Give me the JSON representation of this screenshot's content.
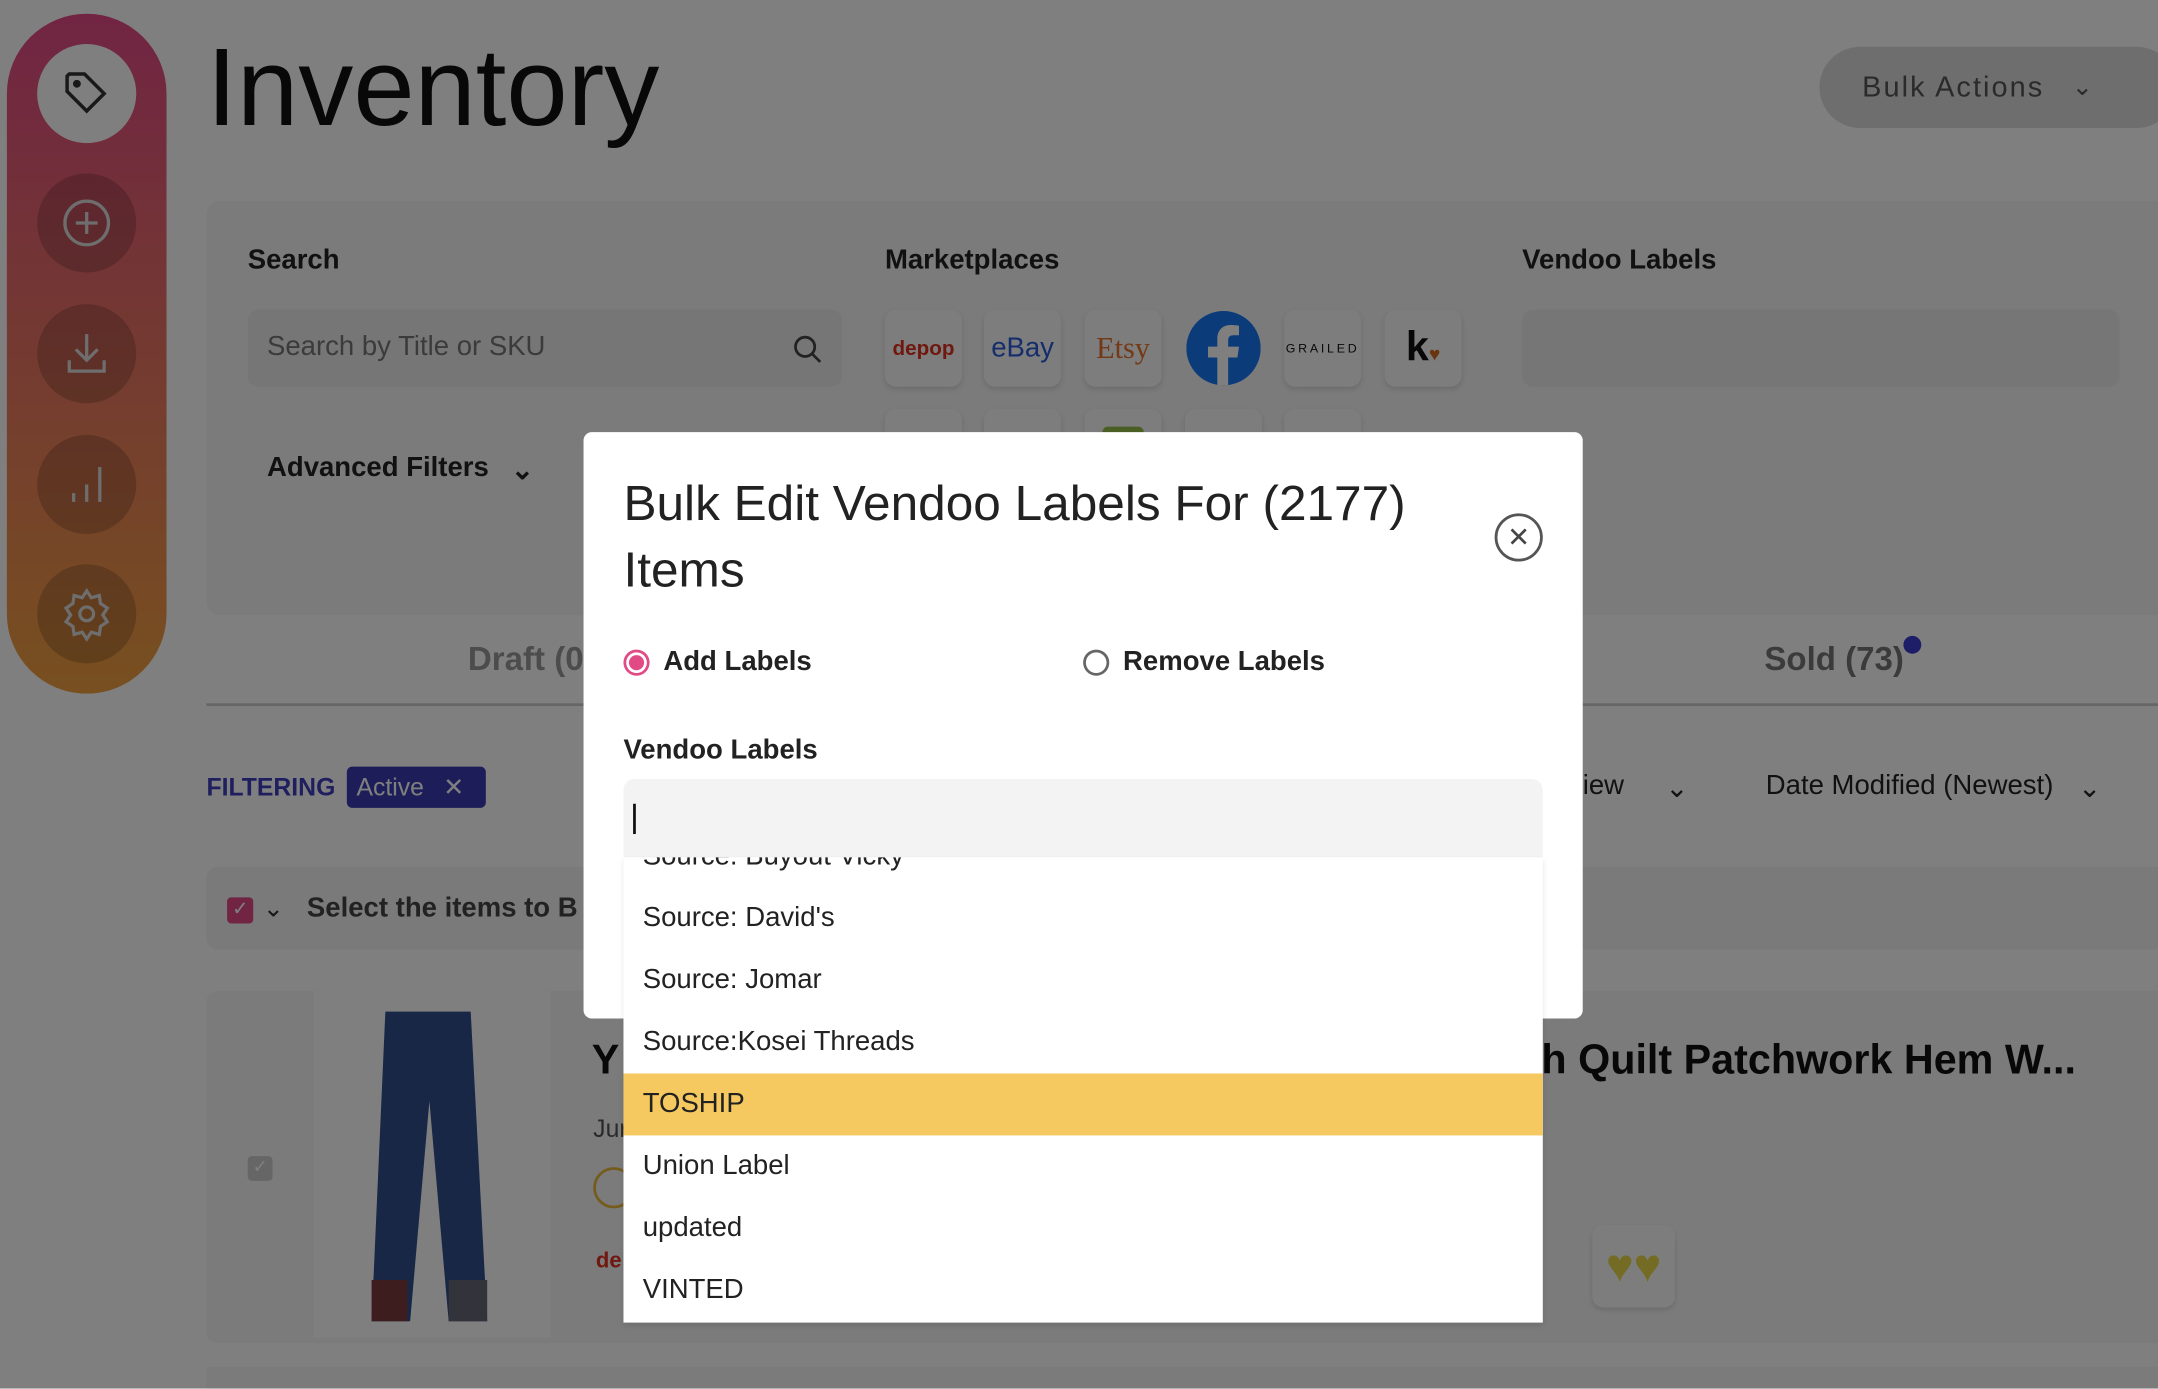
{
  "page": {
    "title": "Inventory",
    "bulk_actions": "Bulk Actions"
  },
  "sidebar": {
    "items": [
      {
        "icon": "tag-icon",
        "active": true
      },
      {
        "icon": "plus-circle-icon"
      },
      {
        "icon": "download-icon"
      },
      {
        "icon": "bar-chart-icon"
      },
      {
        "icon": "gear-icon"
      }
    ]
  },
  "filters": {
    "search_label": "Search",
    "search_placeholder": "Search by Title or SKU",
    "marketplaces_label": "Marketplaces",
    "marketplaces": [
      "depop",
      "eBay",
      "Etsy",
      "Facebook",
      "GRAILED",
      "Kidizen"
    ],
    "vendoo_labels_label": "Vendoo Labels",
    "advanced_filters": "Advanced Filters"
  },
  "tabs": {
    "draft": "Draft (0",
    "sold": "Sold (73)"
  },
  "filtering": {
    "label": "FILTERING",
    "chip": "Active",
    "view_fragment": "iew",
    "sort": "Date Modified (Newest)"
  },
  "select_bar": {
    "text": "Select the items to B"
  },
  "product": {
    "title_start": "Y",
    "title_end": "h Quilt Patchwork Hem W...",
    "date_fragment": "Jur",
    "marketplace_fragment": "de"
  },
  "modal": {
    "title": "Bulk Edit Vendoo Labels For (2177) Items",
    "add_labels": "Add Labels",
    "remove_labels": "Remove Labels",
    "selected_mode": "add",
    "field_label": "Vendoo Labels",
    "input_value": "",
    "options": [
      "Source: Buyout Vicky",
      "Source: David's",
      "Source: Jomar",
      "Source:Kosei Threads",
      "TOSHIP",
      "Union Label",
      "updated",
      "VINTED"
    ],
    "highlighted": "TOSHIP"
  },
  "colors": {
    "accent": "#e24a86",
    "highlight": "#f5c95f",
    "filter_chip": "#3b3bb3"
  }
}
